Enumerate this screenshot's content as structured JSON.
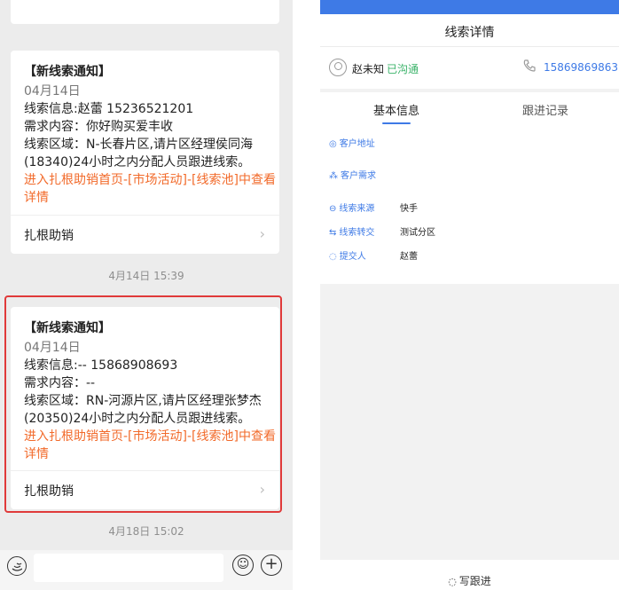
{
  "chat": {
    "cards": [
      {
        "title": "【新线索通知】",
        "date": "04月14日",
        "info": "线索信息:赵蕾 15236521201",
        "need": "需求内容：你好购买爱丰收",
        "region_line1": "线索区域：N-长春片区,请片区经理侯同海",
        "region_line2": "(18340)24小时之内分配人员跟进线索。",
        "link_line1": "进入扎根助销首页-[市场活动]-[线索池]中查看",
        "link_line2": "详情",
        "footer": "扎根助销"
      },
      {
        "title": "【新线索通知】",
        "date": "04月14日",
        "info": "线索信息:-- 15868908693",
        "need": "需求内容：--",
        "region_line1": "线索区域：RN-河源片区,请片区经理张梦杰",
        "region_line2": "(20350)24小时之内分配人员跟进线索。",
        "link_line1": "进入扎根助销首页-[市场活动]-[线索池]中查看",
        "link_line2": "详情",
        "footer": "扎根助销"
      }
    ],
    "times": [
      "4月14日 15:39",
      "4月18日 15:02"
    ],
    "chevron": "›",
    "input_icons": {
      "voice": "voice-icon",
      "emoji": "emoji-icon",
      "plus": "plus-icon"
    }
  },
  "detail": {
    "title": "线索详情",
    "contact": {
      "name": "赵未知",
      "status": "已沟通",
      "phone": "15869869863"
    },
    "tabs": [
      "基本信息",
      "跟进记录"
    ],
    "fields": [
      {
        "label": "客户地址",
        "value": "",
        "icon": "location-icon"
      },
      {
        "label": "客户需求",
        "value": "",
        "icon": "tree-icon"
      },
      {
        "label": "线索来源",
        "value": "快手",
        "icon": "source-icon"
      },
      {
        "label": "线索转交",
        "value": "测试分区",
        "icon": "transfer-icon"
      },
      {
        "label": "提交人",
        "value": "赵蕾",
        "icon": "chat-icon"
      }
    ],
    "write_followup": "写跟进"
  },
  "colors": {
    "accent_blue": "#3e7ae6",
    "link_orange": "#f26a2a",
    "status_green": "#3bb36a",
    "highlight_red": "#e03a3a"
  }
}
